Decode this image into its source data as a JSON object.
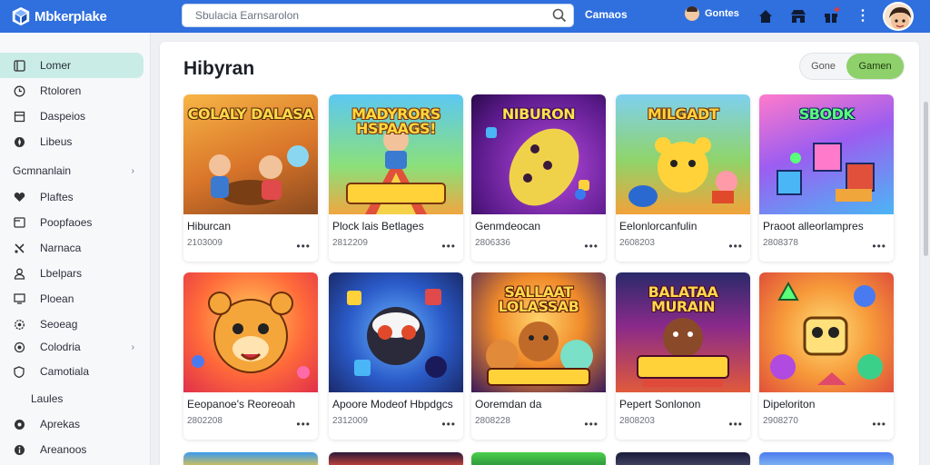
{
  "app": {
    "name": "Mbkerplake"
  },
  "search": {
    "placeholder": "Sbulacia Earnsarolon"
  },
  "topnav": {
    "link": "Camaos",
    "user": "Gontes"
  },
  "colors": {
    "topbar": "#2f6fde",
    "accent": "#8ed06a",
    "active_side": "#c9ece7"
  },
  "sidebar": {
    "items": [
      {
        "label": "Lomer",
        "icon": "home-icon",
        "active": true
      },
      {
        "label": "Rtoloren",
        "icon": "clock-icon"
      },
      {
        "label": "Daspeios",
        "icon": "bookmark-icon"
      },
      {
        "label": "Libeus",
        "icon": "compass-icon"
      }
    ],
    "section1": {
      "label": "Gcmnanlain"
    },
    "items2": [
      {
        "label": "Plaftes",
        "icon": "heart-icon"
      },
      {
        "label": "Poopfaoes",
        "icon": "folder-icon"
      },
      {
        "label": "Narnaca",
        "icon": "tools-icon"
      },
      {
        "label": "Lbelpars",
        "icon": "person-icon"
      },
      {
        "label": "Ploean",
        "icon": "display-icon"
      },
      {
        "label": "Seoeag",
        "icon": "gear-icon"
      }
    ],
    "section2": {
      "label": "Colodria"
    },
    "items3": [
      {
        "label": "Camotiala",
        "icon": "shield-icon"
      }
    ],
    "sub": {
      "label": "Laules"
    },
    "items4": [
      {
        "label": "Aprekas",
        "icon": "star-icon"
      },
      {
        "label": "Areanoos",
        "icon": "info-icon"
      }
    ]
  },
  "main": {
    "title": "Hibyran",
    "toggle": {
      "option_a": "Gone",
      "option_b": "Gamen"
    }
  },
  "cards": [
    {
      "thumb_text": "COLALY DALASA",
      "title": "Hiburcan",
      "date": "2103009",
      "theme": "wood"
    },
    {
      "thumb_text": "MADYRORS HSPAAGS!",
      "title": "Plock lais Betlages",
      "date": "2812209",
      "theme": "slide"
    },
    {
      "thumb_text": "NIBURON",
      "title": "Genmdeocan",
      "date": "2806336",
      "theme": "purple"
    },
    {
      "thumb_text": "MILGADT",
      "title": "Eelonlorcanfulin",
      "date": "2608203",
      "theme": "bear"
    },
    {
      "thumb_text": "SBODK",
      "title": "Praoot alleorlampres",
      "date": "2808378",
      "theme": "blocks"
    },
    {
      "thumb_text": "",
      "title": "Eeopanoe's Reoreoah",
      "date": "2802208",
      "theme": "orangebear"
    },
    {
      "thumb_text": "",
      "title": "Apoore Modeof Hbpdgcs",
      "date": "2312009",
      "theme": "monster"
    },
    {
      "thumb_text": "SALLAAT LOLASSAB",
      "title": "Ooremdan da",
      "date": "2808228",
      "theme": "bears"
    },
    {
      "thumb_text": "BALATAA MURAIN",
      "title": "Pepert Sonlonon",
      "date": "2808203",
      "theme": "stadium"
    },
    {
      "thumb_text": "",
      "title": "Dipeloriton",
      "date": "2908270",
      "theme": "shapes"
    }
  ],
  "peek_cards": [
    {
      "theme": "sky"
    },
    {
      "theme": "dark"
    },
    {
      "theme": "green"
    },
    {
      "theme": "night"
    },
    {
      "theme": "blue"
    }
  ]
}
